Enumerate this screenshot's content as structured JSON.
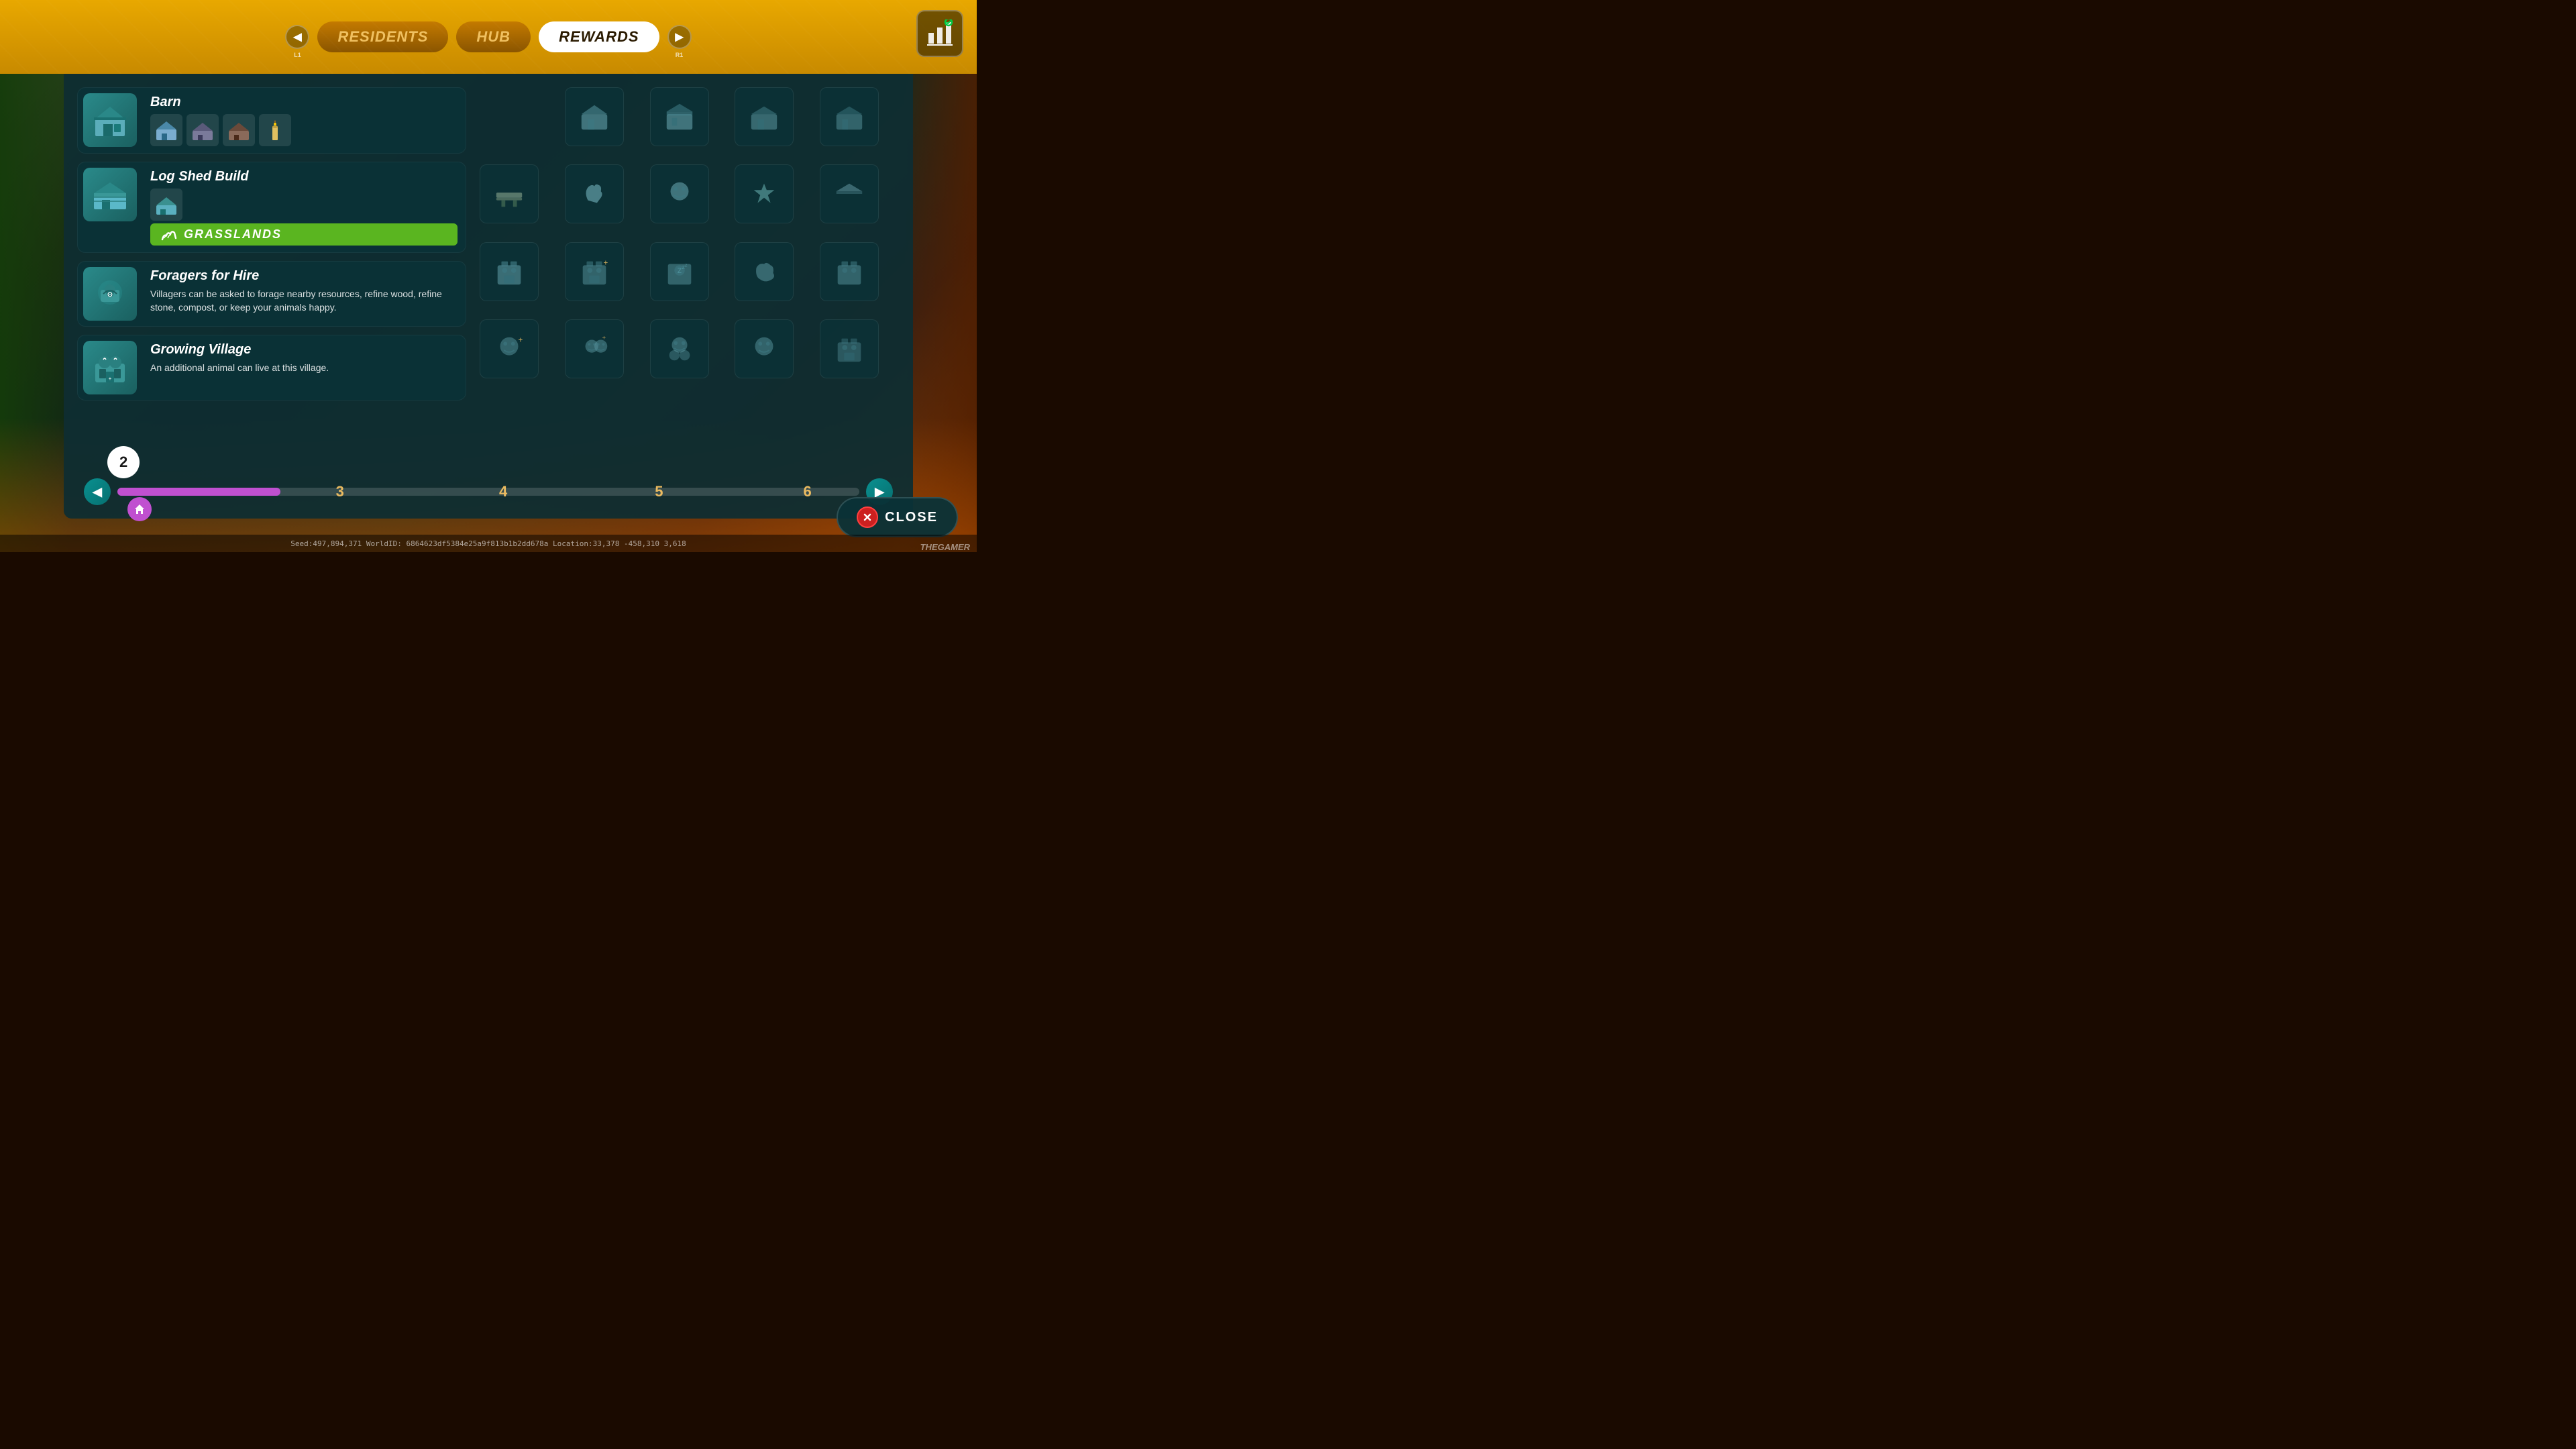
{
  "tabs": {
    "left_arrow_label": "L1",
    "right_arrow_label": "R1",
    "items": [
      {
        "label": "RESIDENTS",
        "active": false
      },
      {
        "label": "HUB",
        "active": false
      },
      {
        "label": "REWARDS",
        "active": true
      }
    ]
  },
  "rewards": [
    {
      "id": "barn",
      "title": "Barn",
      "icon": "🏠",
      "sub_icons": [
        "🏠",
        "🏠",
        "🏚️",
        "🕯️"
      ],
      "description": ""
    },
    {
      "id": "log-shed-build",
      "title": "Log Shed Build",
      "icon": "🏗️",
      "sub_icons": [
        "🏠"
      ],
      "description": "",
      "banner": "GRASSLANDS"
    },
    {
      "id": "foragers-for-hire",
      "title": "Foragers for Hire",
      "icon": "🌿",
      "description": "Villagers can be asked to forage nearby resources, refine wood, refine stone, compost, or keep your animals happy.",
      "sub_icons": []
    },
    {
      "id": "growing-village",
      "title": "Growing Village",
      "icon": "🐄",
      "description": "An additional animal can live at this village.",
      "sub_icons": []
    }
  ],
  "progress": {
    "current_level": 2,
    "nodes": [
      "2",
      "3",
      "4",
      "5",
      "6"
    ]
  },
  "close_button": {
    "label": "CLOSE"
  },
  "bottom_info": {
    "text": "Seed:497,894,371   WorldID: 6864623df5384e25a9f813b1b2dd678a   Location:33,378 -458,310 3,618"
  },
  "watermark": {
    "label": "THEGAMER"
  },
  "grid_items": [
    "building1",
    "building2",
    "building3",
    "building4",
    "plank",
    "hand",
    "face1",
    "gems",
    "roof",
    "villager1",
    "villager2",
    "villager3",
    "cloud",
    "villager4",
    "face2",
    "face3",
    "face4",
    "face5",
    "face6"
  ]
}
